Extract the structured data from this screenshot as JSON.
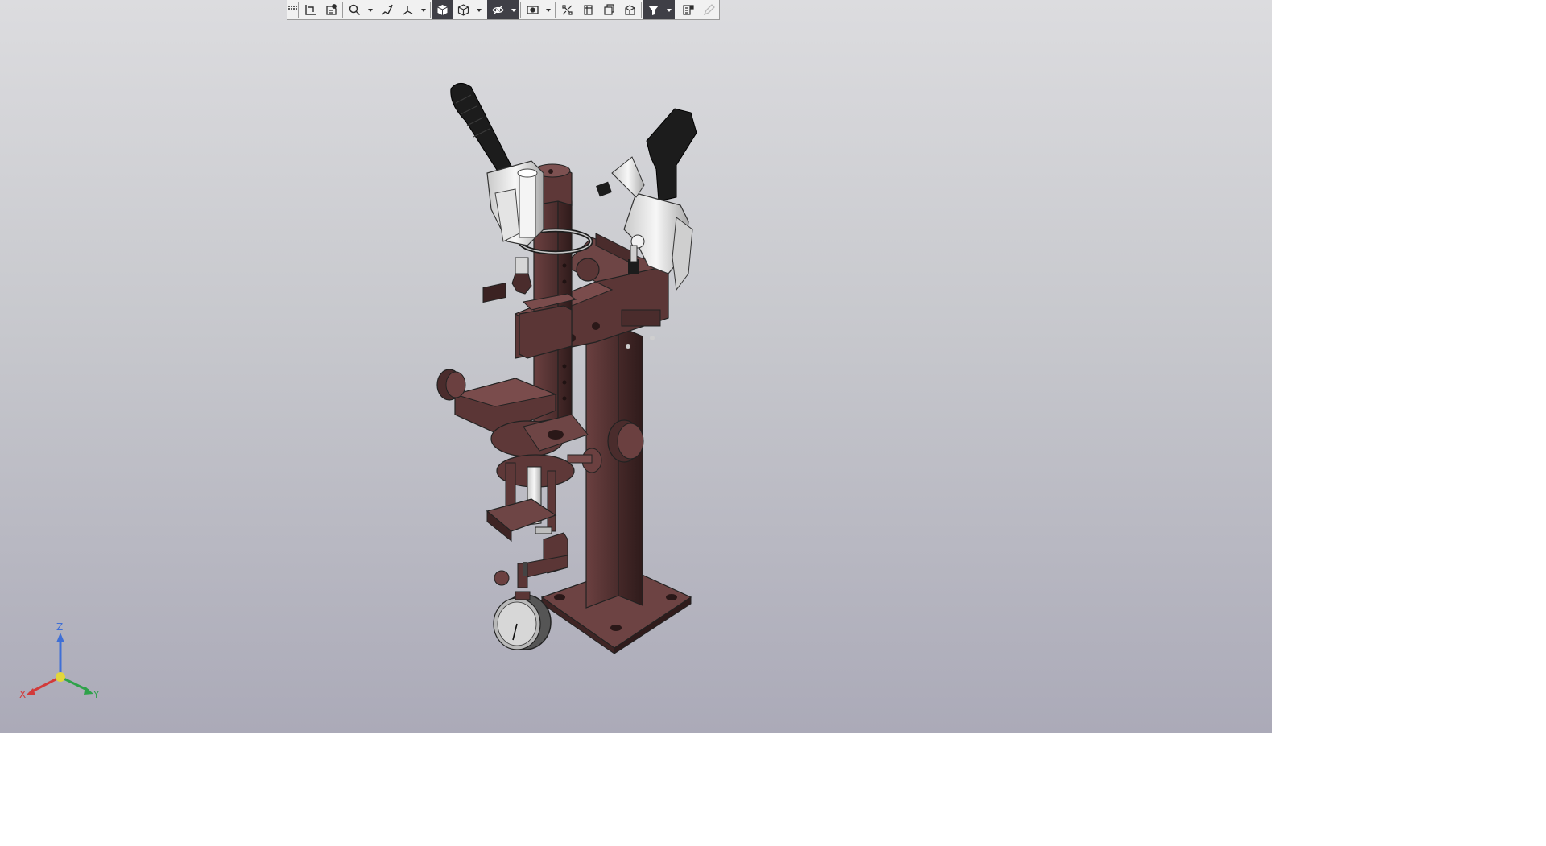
{
  "toolbar": {
    "buttons": [
      {
        "id": "grip",
        "icon": "toolbar-grip-icon"
      },
      {
        "id": "orient",
        "icon": "orientation-icon"
      },
      {
        "id": "section",
        "icon": "section-view-icon"
      },
      {
        "id": "zoom",
        "icon": "zoom-icon"
      },
      {
        "id": "zoom-dd",
        "icon": "chevron-down-icon"
      },
      {
        "id": "prev-view",
        "icon": "previous-view-icon"
      },
      {
        "id": "axes",
        "icon": "view-orientation-icon"
      },
      {
        "id": "axes-dd",
        "icon": "chevron-down-icon"
      },
      {
        "id": "shaded",
        "icon": "shaded-cube-icon"
      },
      {
        "id": "display",
        "icon": "display-style-icon"
      },
      {
        "id": "display-dd",
        "icon": "chevron-down-icon"
      },
      {
        "id": "hide",
        "icon": "hide-show-icon"
      },
      {
        "id": "hide-dd",
        "icon": "chevron-down-icon"
      },
      {
        "id": "scene",
        "icon": "scene-icon"
      },
      {
        "id": "scene-dd",
        "icon": "chevron-down-icon"
      },
      {
        "id": "perspective",
        "icon": "perspective-icon"
      },
      {
        "id": "sheet1",
        "icon": "sheet-icon"
      },
      {
        "id": "sheet2",
        "icon": "sheet-stack-icon"
      },
      {
        "id": "sheet3",
        "icon": "sheet-view-icon"
      },
      {
        "id": "filter",
        "icon": "filter-icon"
      },
      {
        "id": "filter-dd",
        "icon": "chevron-down-icon"
      },
      {
        "id": "props",
        "icon": "properties-icon"
      },
      {
        "id": "edit",
        "icon": "pencil-icon"
      }
    ]
  },
  "triad": {
    "x": "X",
    "y": "Y",
    "z": "Z"
  },
  "colors": {
    "viewport_top": "#dcdcdf",
    "viewport_bottom": "#abaab8",
    "body_metal": "#5a3535",
    "body_metal_dark": "#3e2424",
    "handle_black": "#1c1c1c",
    "chrome": "#e2e2e2",
    "axis_x": "#d23a3a",
    "axis_y": "#2fa24a",
    "axis_z": "#3f6fd6"
  }
}
